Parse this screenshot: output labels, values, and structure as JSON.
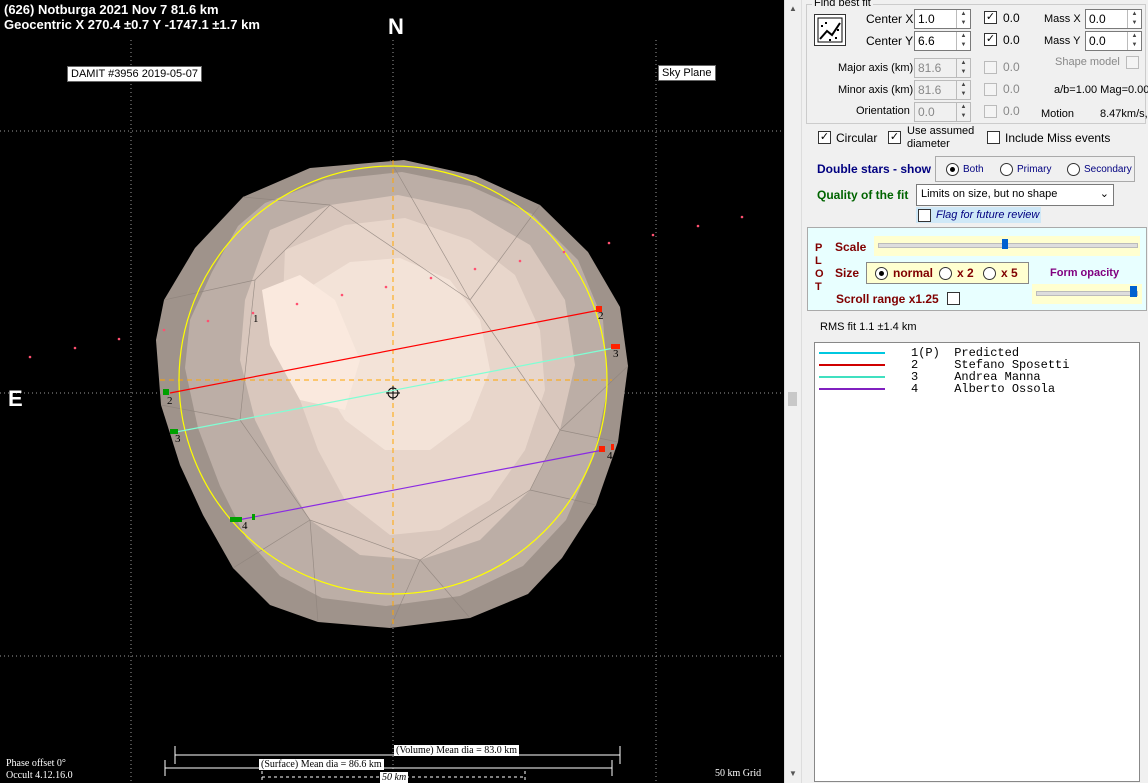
{
  "plot": {
    "title_line1": "(626) Notburga  2021 Nov 7  81.6 km",
    "title_line2": "Geocentric  X  270.4 ±0.7  Y -1747.1 ±1.7 km",
    "north_label": "N",
    "east_label": "E",
    "model_tag": "DAMIT #3956 2019-05-07",
    "plane_tag": "Sky Plane",
    "chord_labels": [
      "1",
      "2",
      "2",
      "3",
      "3",
      "4",
      "4"
    ],
    "volume_dia": "(Volume) Mean dia = 83.0 km",
    "surface_dia": "(Surface) Mean dia = 86.6 km",
    "scale_label": "50 km",
    "phase_offset": "Phase offset 0°",
    "version": "Occult 4.12.16.0",
    "grid_label": "50 km Grid",
    "colors": {
      "background": "#000000",
      "limb_circle": "#ffff00",
      "chord2": "#ff0000",
      "chord3": "#7fffd4",
      "chord4": "#8a2be2",
      "axes": "#ffa500"
    }
  },
  "panel": {
    "find_best_fit": "Find best fit",
    "fit_icon": "find-fit-icon",
    "center_x_label": "Center X",
    "center_x_value": "1.0",
    "center_y_label": "Center Y",
    "center_y_value": "6.6",
    "center_x_check_value": "0.0",
    "center_y_check_value": "0.0",
    "mass_x_label": "Mass X",
    "mass_x_value": "0.0",
    "mass_y_label": "Mass Y",
    "mass_y_value": "0.0",
    "shape_model_label": "Shape model",
    "major_axis_label": "Major axis (km)",
    "major_axis_value": "81.6",
    "major_check_value": "0.0",
    "minor_axis_label": "Minor axis (km)",
    "minor_axis_value": "81.6",
    "minor_check_value": "0.0",
    "orientation_label": "Orientation",
    "orientation_value": "0.0",
    "orientation_check_value": "0.0",
    "ab_mag": "a/b=1.00  Mag=0.00",
    "motion_label": "Motion",
    "motion_value": "8.47km/s,",
    "circular_label": "Circular",
    "use_assumed_label_1": "Use assumed",
    "use_assumed_label_2": "diameter",
    "include_miss_label": "Include Miss events",
    "double_stars_label": "Double stars - show",
    "double_options": [
      "Both",
      "Primary",
      "Secondary"
    ],
    "quality_label": "Quality of the fit",
    "quality_value": "Limits on size, but no shape",
    "flag_label": "Flag for future review",
    "plot_letters": [
      "P",
      "L",
      "O",
      "T"
    ],
    "scale_label": "Scale",
    "size_label": "Size",
    "size_options": [
      "normal",
      "x 2",
      "x 5"
    ],
    "form_opacity_label": "Form opacity",
    "scroll_range_label": "Scroll range x1.25",
    "rms_fit": "RMS fit  1.1 ±1.4 km",
    "legend": [
      {
        "text": "1(P)  Predicted",
        "color": "#00c8e0"
      },
      {
        "text": "2     Stefano Sposetti",
        "color": "#d00000"
      },
      {
        "text": "3     Andrea Manna",
        "color": "#40e0c0"
      },
      {
        "text": "4     Alberto Ossola",
        "color": "#8020c0"
      }
    ]
  }
}
